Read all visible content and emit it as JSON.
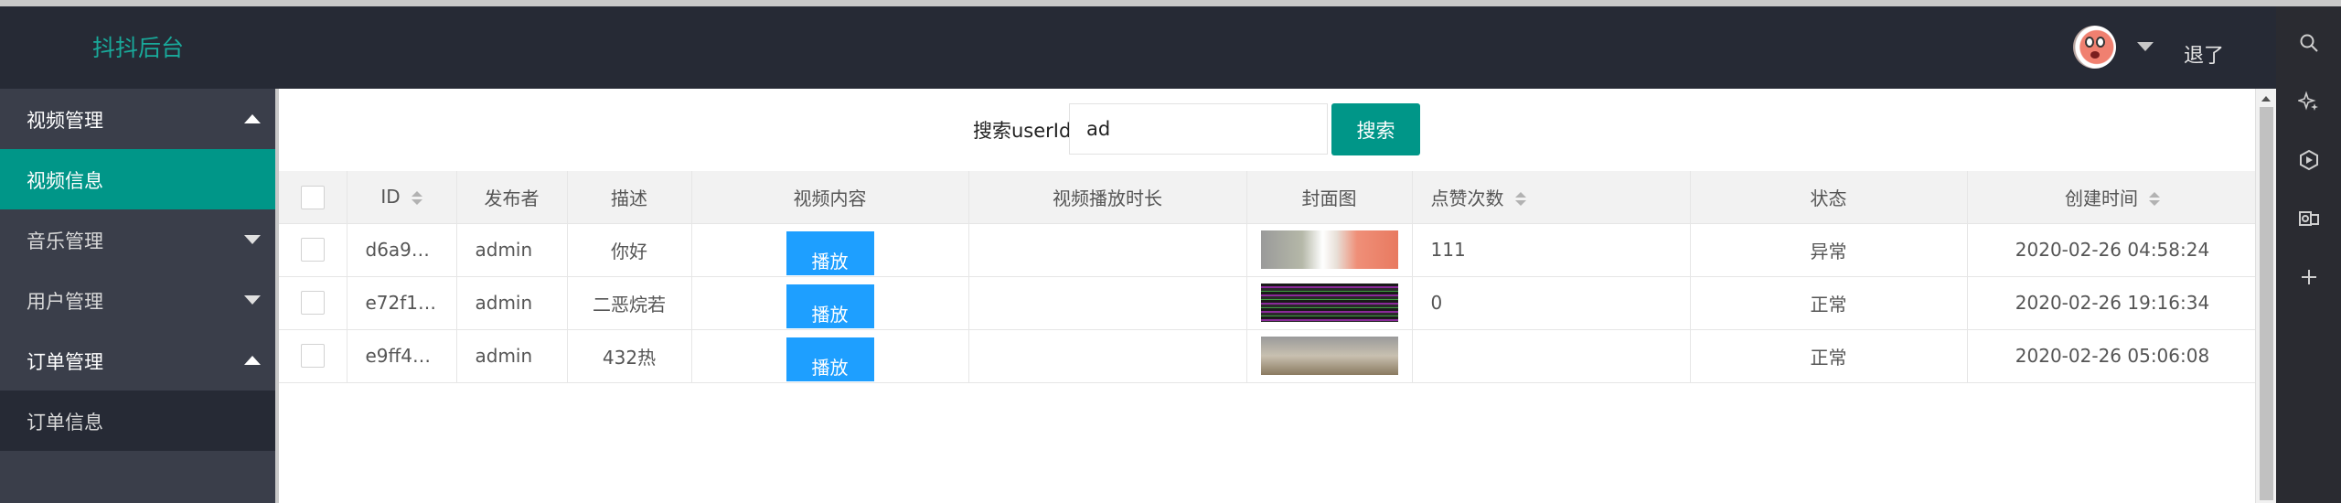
{
  "header": {
    "brand": "抖抖后台",
    "logout_label": "退了"
  },
  "sidebar": {
    "items": [
      {
        "label": "视频管理",
        "expanded": true
      },
      {
        "label": "视频信息",
        "active": true
      },
      {
        "label": "音乐管理",
        "expanded": false
      },
      {
        "label": "用户管理",
        "expanded": false
      },
      {
        "label": "订单管理",
        "expanded": true
      },
      {
        "label": "订单信息"
      }
    ]
  },
  "search": {
    "label": "搜索userId",
    "value": "ad",
    "button_label": "搜索"
  },
  "table": {
    "columns": [
      "ID",
      "发布者",
      "描述",
      "视频内容",
      "视频播放时长",
      "封面图",
      "点赞次数",
      "状态",
      "创建时间"
    ],
    "play_label": "播放",
    "rows": [
      {
        "id": "d6a9…",
        "publisher": "admin",
        "desc": "你好",
        "duration": "",
        "likes": "111",
        "status": "异常",
        "created": "2020-02-26 04:58:24"
      },
      {
        "id": "e72f1…",
        "publisher": "admin",
        "desc": "二恶烷若",
        "duration": "",
        "likes": "0",
        "status": "正常",
        "created": "2020-02-26 19:16:34"
      },
      {
        "id": "e9ff4…",
        "publisher": "admin",
        "desc": "432热",
        "duration": "",
        "likes": "",
        "status": "正常",
        "created": "2020-02-26 05:06:08"
      }
    ]
  },
  "colors": {
    "header_bg": "#262a35",
    "sidebar_bg": "#3a3e4a",
    "accent": "#009688",
    "play_button": "#1e9fff",
    "brand_text": "#19a99a"
  },
  "side_panel_icons": [
    "search-icon",
    "sparkle-icon",
    "copilot-icon",
    "outlook-icon",
    "plus-icon"
  ]
}
